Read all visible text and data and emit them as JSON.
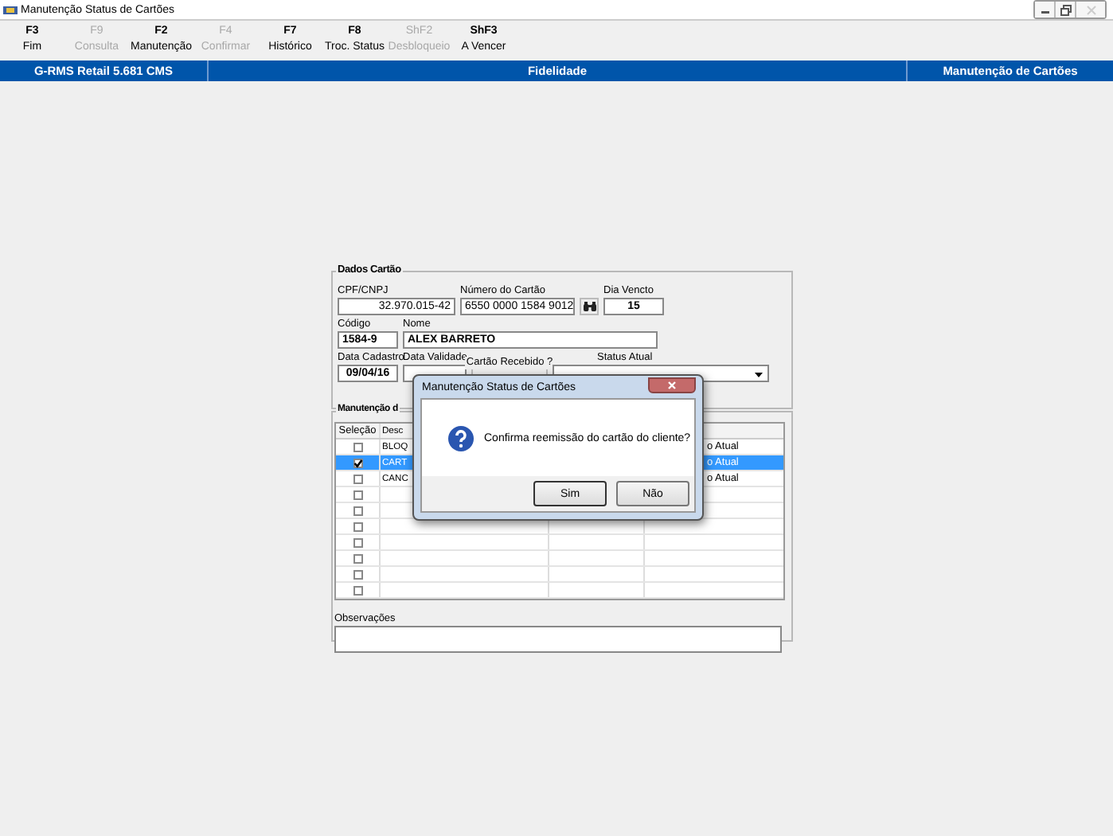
{
  "window": {
    "title": "Manutenção Status de Cartões"
  },
  "toolbar": [
    {
      "key": "F3",
      "label": "Fim",
      "disabled": false
    },
    {
      "key": "F9",
      "label": "Consulta",
      "disabled": true
    },
    {
      "key": "F2",
      "label": "Manutenção",
      "disabled": false
    },
    {
      "key": "F4",
      "label": "Confirmar",
      "disabled": true
    },
    {
      "key": "F7",
      "label": "Histórico",
      "disabled": false
    },
    {
      "key": "F8",
      "label": "Troc. Status",
      "disabled": false
    },
    {
      "key": "ShF2",
      "label": "Desbloqueio",
      "disabled": true
    },
    {
      "key": "ShF3",
      "label": "A Vencer",
      "disabled": false
    }
  ],
  "header_bar": [
    "G-RMS Retail 5.681 CMS",
    "Fidelidade",
    "Manutenção de Cartões"
  ],
  "card": {
    "title": "Dados Cartão",
    "cpf_cnpj": {
      "label": "CPF/CNPJ",
      "value": "32.970.015-42"
    },
    "card_number": {
      "label": "Número do Cartão",
      "value": "6550 0000 1584 9012"
    },
    "due_day": {
      "label": "Dia Vencto",
      "value": "15"
    },
    "code": {
      "label": "Código",
      "value": "1584-9"
    },
    "name": {
      "label": "Nome",
      "value": "ALEX BARRETO"
    },
    "registration_date": {
      "label": "Data Cadastro",
      "value": "09/04/16"
    },
    "expiry_date": {
      "label": "Data Validade"
    },
    "card_received": {
      "label": "Cartão Recebido ?"
    },
    "current_status": {
      "label": "Status Atual"
    }
  },
  "maintenance": {
    "title": "Manutenção d",
    "columns": [
      "Seleção",
      "Desc"
    ],
    "rows": [
      {
        "checked": false,
        "selected": false,
        "description": "BLOQ",
        "status": "o Atual"
      },
      {
        "checked": true,
        "selected": true,
        "description": "CART",
        "status": "o Atual"
      },
      {
        "checked": false,
        "selected": false,
        "description": "CANC",
        "status": "o Atual"
      },
      {
        "checked": false,
        "selected": false
      },
      {
        "checked": false,
        "selected": false
      },
      {
        "checked": false,
        "selected": false
      },
      {
        "checked": false,
        "selected": false
      },
      {
        "checked": false,
        "selected": false
      },
      {
        "checked": false,
        "selected": false
      },
      {
        "checked": false,
        "selected": false
      }
    ],
    "notes_label": "Observações"
  },
  "dialog": {
    "title": "Manutenção Status de Cartões",
    "message": "Confirma reemissão do cartão do cliente?",
    "buttons": [
      "Sim",
      "Não"
    ]
  }
}
